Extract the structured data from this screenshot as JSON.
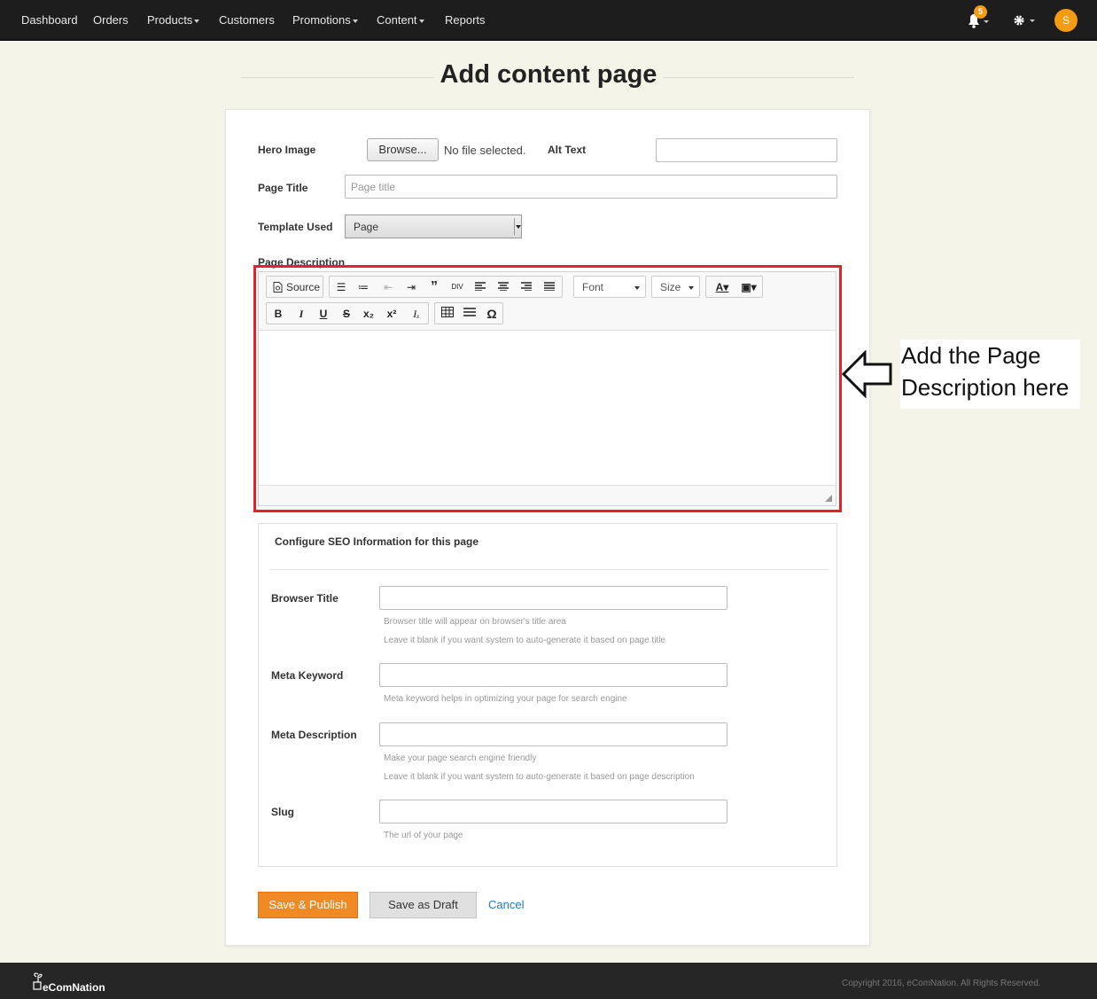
{
  "nav": {
    "items": [
      "Dashboard",
      "Orders",
      "Products",
      "Customers",
      "Promotions",
      "Content",
      "Reports"
    ],
    "notification_count": "5",
    "avatar_initial": "S"
  },
  "page": {
    "title": "Add content page"
  },
  "form": {
    "hero_image_label": "Hero Image",
    "browse_label": "Browse...",
    "no_file_text": "No file selected.",
    "alt_text_label": "Alt Text",
    "page_title_label": "Page Title",
    "page_title_placeholder": "Page title",
    "template_label": "Template Used",
    "template_value": "Page",
    "description_label": "Page Description"
  },
  "editor": {
    "source_label": "Source",
    "font_label": "Font",
    "size_label": "Size"
  },
  "annotation": {
    "line1": "Add the Page",
    "line2": "Description here"
  },
  "seo": {
    "title": "Configure SEO Information for this page",
    "browser_title_label": "Browser Title",
    "browser_title_help1": "Browser title will appear on browser's title area",
    "browser_title_help2": "Leave it blank if you want system to auto-generate it based on page title",
    "meta_keyword_label": "Meta Keyword",
    "meta_keyword_help": "Meta keyword helps in optimizing your page for search engine",
    "meta_description_label": "Meta Description",
    "meta_description_help1": "Make your page search engine friendly",
    "meta_description_help2": "Leave it blank if you want system to auto-generate it based on page description",
    "slug_label": "Slug",
    "slug_help": "The url of your page"
  },
  "actions": {
    "publish_label": "Save & Publish",
    "draft_label": "Save as Draft",
    "cancel_label": "Cancel"
  },
  "footer": {
    "brand": "eComNation",
    "copyright": "Copyright 2016, eComNation. All Rights Reserved."
  },
  "colors": {
    "nav_bg": "#1d1d1d",
    "page_bg": "#f5f4e8",
    "accent": "#f08a24",
    "highlight": "#e8202a",
    "link": "#1a7bc9"
  }
}
